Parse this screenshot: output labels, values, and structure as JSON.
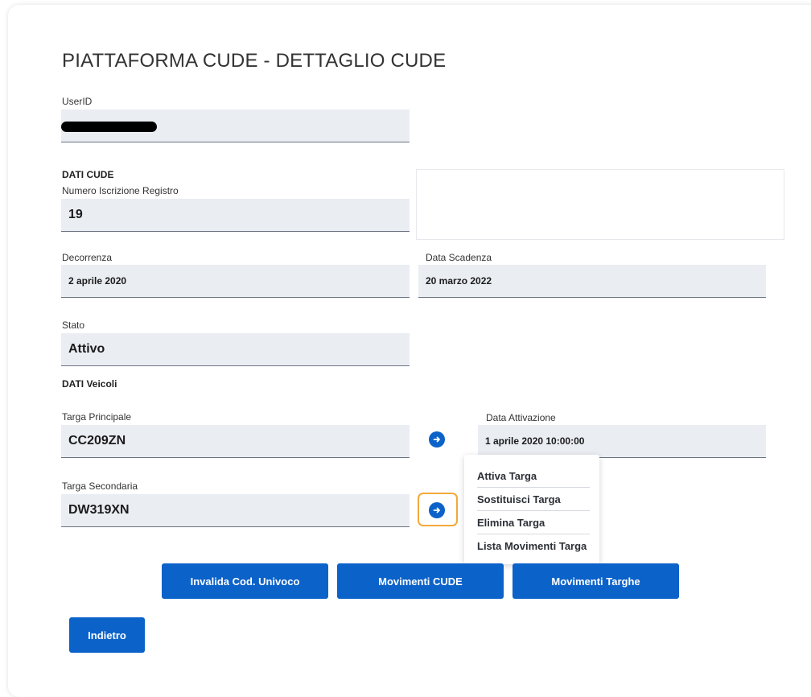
{
  "page": {
    "title": "PIATTAFORMA CUDE - DETTAGLIO CUDE"
  },
  "user": {
    "label": "UserID",
    "value_redacted": true
  },
  "dati_cude": {
    "section_title": "DATI CUDE",
    "numero_label": "Numero Iscrizione Registro",
    "numero_value": "19",
    "decorrenza_label": "Decorrenza",
    "decorrenza_value": "2 aprile 2020",
    "scadenza_label": "Data Scadenza",
    "scadenza_value": "20 marzo 2022",
    "stato_label": "Stato",
    "stato_value": "Attivo"
  },
  "dati_veicoli": {
    "section_title": "DATI Veicoli",
    "targa_principale_label": "Targa Principale",
    "targa_principale_value": "CC209ZN",
    "data_attivazione_label": "Data Attivazione",
    "data_attivazione_value": "1 aprile 2020 10:00:00",
    "targa_secondaria_label": "Targa Secondaria",
    "targa_secondaria_value": "DW319XN"
  },
  "targa_menu": {
    "items": [
      "Attiva Targa",
      "Sostituisci Targa",
      "Elimina Targa",
      "Lista Movimenti Targa"
    ]
  },
  "actions": {
    "invalida": "Invalida Cod. Univoco",
    "movimenti_cude": "Movimenti CUDE",
    "movimenti_targhe": "Movimenti Targhe",
    "indietro": "Indietro"
  },
  "colors": {
    "primary": "#0b62c9",
    "field_bg": "#eaedf2",
    "focus": "#f2a93b"
  },
  "icons": {
    "row_action": "arrow-right-circle-icon"
  }
}
